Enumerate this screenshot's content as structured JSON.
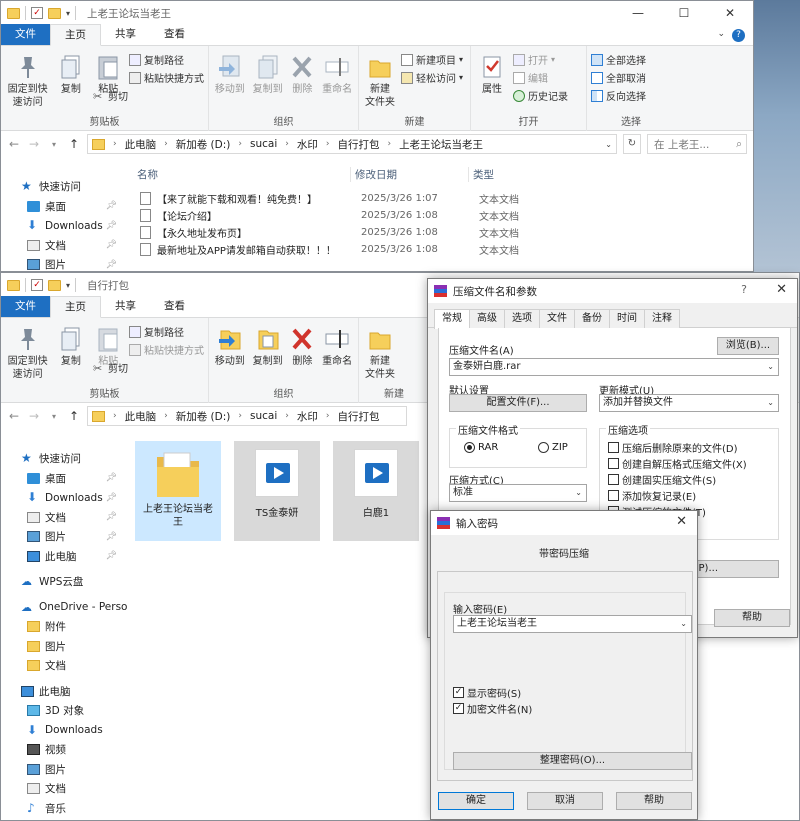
{
  "window1": {
    "title": "上老王论坛当老王",
    "tabs": [
      "文件",
      "主页",
      "共享",
      "查看"
    ],
    "ribbon": {
      "pin_quick": "固定到快\n速访问",
      "copy": "复制",
      "paste": "粘贴",
      "copy_path": "复制路径",
      "paste_shortcut": "粘贴快捷方式",
      "cut": "剪切",
      "clipboard_group": "剪贴板",
      "move_to": "移动到",
      "copy_to": "复制到",
      "delete": "删除",
      "rename": "重命名",
      "organize_group": "组织",
      "new_folder": "新建\n文件夹",
      "new_item": "新建项目",
      "easy_access": "轻松访问",
      "new_group": "新建",
      "properties": "属性",
      "open": "打开",
      "edit": "编辑",
      "history": "历史记录",
      "open_group": "打开",
      "select_all": "全部选择",
      "select_none": "全部取消",
      "invert": "反向选择",
      "select_group": "选择"
    },
    "breadcrumb": [
      "此电脑",
      "新加卷 (D:)",
      "sucai",
      "水印",
      "自行打包",
      "上老王论坛当老王"
    ],
    "search_placeholder": "在 上老王...",
    "nav": [
      {
        "label": "快速访问",
        "icon": "star-icon"
      },
      {
        "label": "桌面",
        "icon": "desktop-icon"
      },
      {
        "label": "Downloads",
        "icon": "download-icon"
      },
      {
        "label": "文档",
        "icon": "document-icon"
      },
      {
        "label": "图片",
        "icon": "picture-icon"
      }
    ],
    "columns": {
      "name": "名称",
      "date": "修改日期",
      "type": "类型"
    },
    "files": [
      {
        "name": "【来了就能下载和观看！纯免费！】",
        "date": "2025/3/26 1:07",
        "type": "文本文档"
      },
      {
        "name": "【论坛介绍】",
        "date": "2025/3/26 1:08",
        "type": "文本文档"
      },
      {
        "name": "【永久地址发布页】",
        "date": "2025/3/26 1:08",
        "type": "文本文档"
      },
      {
        "name": "最新地址及APP请发邮箱自动获取！！！",
        "date": "2025/3/26 1:08",
        "type": "文本文档"
      }
    ]
  },
  "window2": {
    "title": "自行打包",
    "tabs": [
      "文件",
      "主页",
      "共享",
      "查看"
    ],
    "breadcrumb": [
      "此电脑",
      "新加卷 (D:)",
      "sucai",
      "水印",
      "自行打包"
    ],
    "nav": [
      {
        "label": "快速访问",
        "icon": "star-icon"
      },
      {
        "label": "桌面",
        "icon": "desktop-icon"
      },
      {
        "label": "Downloads",
        "icon": "download-icon"
      },
      {
        "label": "文档",
        "icon": "document-icon"
      },
      {
        "label": "图片",
        "icon": "picture-icon"
      },
      {
        "label": "此电脑",
        "icon": "computer-icon"
      },
      {
        "label": "WPS云盘",
        "icon": "cloud-icon"
      },
      {
        "label": "OneDrive - Perso",
        "icon": "onedrive-icon"
      },
      {
        "label": "附件",
        "icon": "folder-icon"
      },
      {
        "label": "图片",
        "icon": "folder-icon"
      },
      {
        "label": "文档",
        "icon": "folder-icon"
      },
      {
        "label": "此电脑",
        "icon": "computer-icon"
      },
      {
        "label": "3D 对象",
        "icon": "cube-icon"
      },
      {
        "label": "Downloads",
        "icon": "download-icon"
      },
      {
        "label": "视频",
        "icon": "video-icon"
      },
      {
        "label": "图片",
        "icon": "picture-icon"
      },
      {
        "label": "文档",
        "icon": "document-icon"
      },
      {
        "label": "音乐",
        "icon": "music-icon"
      }
    ],
    "tiles": [
      {
        "name": "上老王论坛当老\n王",
        "kind": "folder"
      },
      {
        "name": "TS金泰妍",
        "kind": "video"
      },
      {
        "name": "白鹿1",
        "kind": "video"
      }
    ]
  },
  "archive_dialog": {
    "title": "压缩文件名和参数",
    "tabs": [
      "常规",
      "高级",
      "选项",
      "文件",
      "备份",
      "时间",
      "注释"
    ],
    "archive_name_label": "压缩文件名(A)",
    "browse": "浏览(B)...",
    "archive_name": "金泰妍白鹿.rar",
    "default_settings": "默认设置",
    "profiles": "配置文件(F)...",
    "update_mode_label": "更新模式(U)",
    "update_mode": "添加并替换文件",
    "format_label": "压缩文件格式",
    "format_rar": "RAR",
    "format_zip": "ZIP",
    "method_label": "压缩方式(C)",
    "method": "标准",
    "options_label": "压缩选项",
    "options": [
      {
        "label": "压缩后删除原来的文件(D)",
        "checked": false
      },
      {
        "label": "创建自解压格式压缩文件(X)",
        "checked": false
      },
      {
        "label": "创建固实压缩文件(S)",
        "checked": false
      },
      {
        "label": "添加恢复记录(E)",
        "checked": false
      },
      {
        "label": "测试压缩的文件(T)",
        "checked": false
      }
    ],
    "set_password_partial": "P)...",
    "help": "帮助"
  },
  "password_dialog": {
    "title": "输入密码",
    "heading": "带密码压缩",
    "enter_label": "输入密码(E)",
    "password": "上老王论坛当老王",
    "show_password": "显示密码(S)",
    "encrypt_names": "加密文件名(N)",
    "organize": "整理密码(O)...",
    "ok": "确定",
    "cancel": "取消",
    "help": "帮助"
  }
}
